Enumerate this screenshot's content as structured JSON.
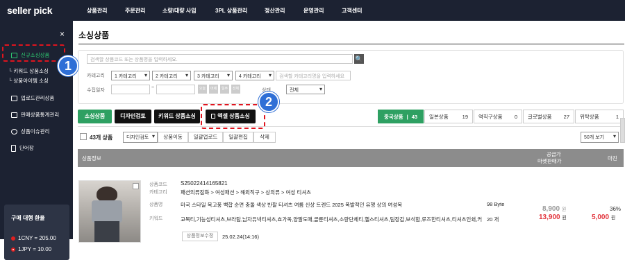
{
  "app": {
    "logo_seller": "seller",
    "logo_pick": "pick"
  },
  "topnav": [
    "상품관리",
    "주문관리",
    "소량/대량 사입",
    "3PL 상품관리",
    "정산관리",
    "운영관리",
    "고객센터"
  ],
  "sidebar": {
    "close": "×",
    "items": [
      "신규소싱상품",
      "키워드 상품소싱",
      "상품아이템 소싱",
      "업로드관리상품",
      "판매상품통계관리",
      "상품이슈관리",
      "단어장"
    ]
  },
  "rates": {
    "title": "구매 대행 환율",
    "cny": "1CNY = 205.00",
    "jpy": "1JPY = 10.00"
  },
  "page": {
    "title": "소싱상품"
  },
  "search": {
    "placeholder": "검색할 상품코드 또는 상품명을 입력하세요.",
    "button": "🔍",
    "category_label": "카테고리",
    "cats": [
      "1 카테고리",
      "2 카테고리",
      "3 카테고리",
      "4 카테고리"
    ],
    "cat_placeholder": "검색할 카테고리명을 입력하세요",
    "date_label": "수집일자",
    "date_sep": "~",
    "quick": [
      "오늘",
      "어제",
      "일주",
      "전체"
    ],
    "status_label": "상태",
    "status_value": "전체"
  },
  "actions": {
    "sourcing": "소싱상품",
    "design": "디자인검토",
    "keyword": "키워드 상품소싱",
    "excel": "엑셀 상품소싱"
  },
  "counts": [
    {
      "label": "중국상품",
      "sep": "|",
      "count": "43"
    },
    {
      "label": "일본상품",
      "count": "19"
    },
    {
      "label": "역직구상품",
      "count": "0"
    },
    {
      "label": "글로벌상품",
      "count": "27"
    },
    {
      "label": "위탁상품",
      "count": "1"
    }
  ],
  "toolbar": {
    "count_label": "43개 상품",
    "design_sel": "디자인검토",
    "move": "상품이동",
    "bulk_upload": "일괄업로드",
    "bulk_edit": "일괄편집",
    "delete": "삭제",
    "page_size": "50개 보기"
  },
  "table": {
    "col_info": "상품정보",
    "col_price_top": "공급가",
    "col_price_bottom": "마켓판매가",
    "col_margin": "마진"
  },
  "product": {
    "code_label": "상품코드",
    "code": "S25022414165821",
    "cat_label": "카테고리",
    "cat": "패션의류잡화 > 여성패션 > 해외직구 > 상의류 > 여성 티셔츠",
    "name_label": "상품명",
    "name": "미국 스타일 복고풍 백합 순면 충돌 색상 반팔 티셔츠 여름 신상 트렌드 2025 폭발적인 유행 상의 여성복",
    "bytes": "98 Byte",
    "kw_label": "키워드",
    "keywords": "교복티,기능성티셔츠,브라탑,남자유넥티셔츠,효가옥,양말도매,골룬티셔츠,소량단체티,헬스티셔츠,팀장갑,보석함,루즈한티셔츠,티셔츠인쇄,커",
    "kw_count": "20 개",
    "supply": "8,900",
    "sale": "13,900",
    "won": "원",
    "margin_pct": "36%",
    "margin": "5,000",
    "edit_btn": "상품정보수정",
    "date": "25.02.24(14:16)"
  },
  "badges": [
    "1",
    "2"
  ]
}
